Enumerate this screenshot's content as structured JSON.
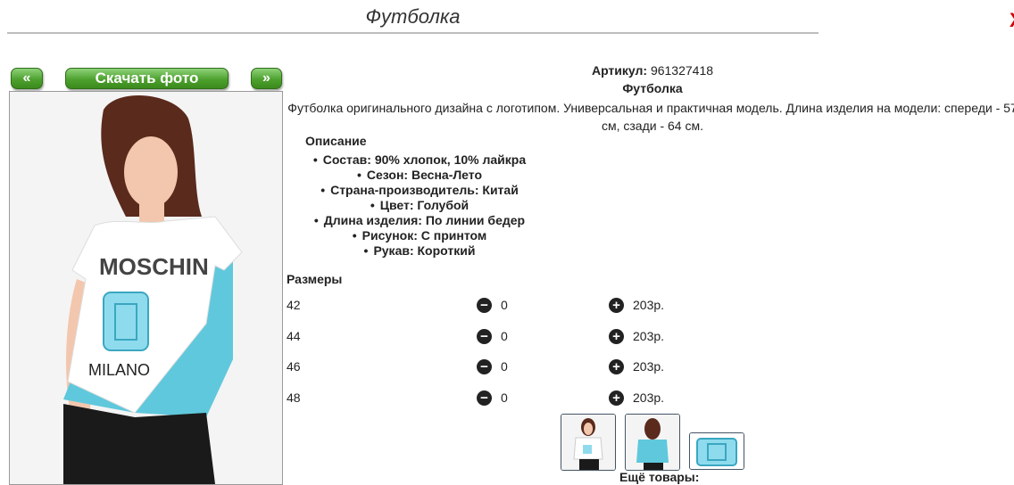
{
  "page": {
    "title": "Футболка",
    "close_label": "X"
  },
  "nav": {
    "prev_label": "«",
    "download_label": "Скачать фото",
    "next_label": "»"
  },
  "product": {
    "article_label": "Артикул:",
    "article_value": "961327418",
    "name": "Футболка",
    "description": "Футболка оригинального дизайна с логотипом. Универсальная и практичная модель. Длина изделия на модели: спереди - 57 см, сзади - 64 см.",
    "photo_print_text": "MOSCHIN",
    "photo_print_sub": "MILANO"
  },
  "opisanie": {
    "heading": "Описание",
    "items": [
      "Состав: 90% хлопок, 10% лайкра",
      "Сезон: Весна-Лето",
      "Страна-производитель: Китай",
      "Цвет: Голубой",
      "Длина изделия: По линии бедер",
      "Рисунок: С принтом",
      "Рукав: Короткий"
    ]
  },
  "sizes": {
    "heading": "Размеры",
    "rows": [
      {
        "size": "42",
        "qty": "0",
        "price": "203р."
      },
      {
        "size": "44",
        "qty": "0",
        "price": "203р."
      },
      {
        "size": "46",
        "qty": "0",
        "price": "203р."
      },
      {
        "size": "48",
        "qty": "0",
        "price": "203р."
      }
    ],
    "minus_icon": "−",
    "plus_icon": "+"
  },
  "more": {
    "label": "Ещё товары:"
  },
  "colors": {
    "button_green": "#4ea12f",
    "shirt_white": "#ffffff",
    "shirt_blue": "#5fc8dc",
    "hair": "#5a2a1c",
    "skin": "#f2c7ad"
  }
}
